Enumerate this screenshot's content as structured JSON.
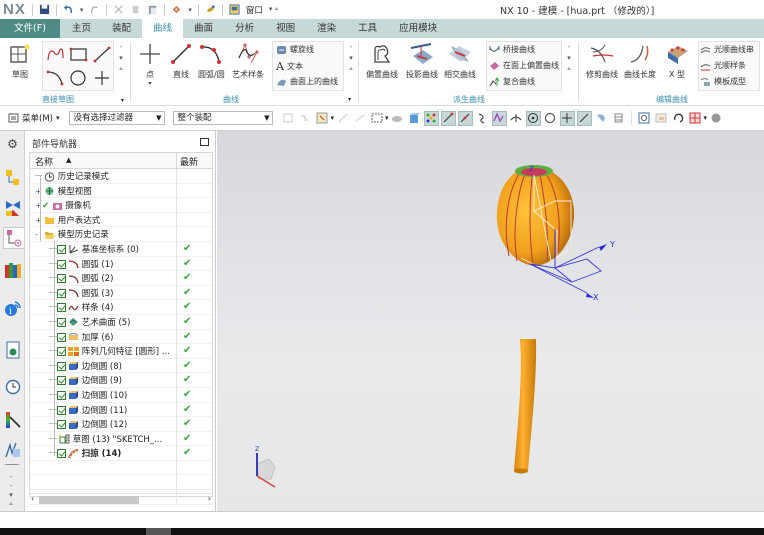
{
  "app": {
    "logo": "NX",
    "title": "NX 10 - 建模 - [hua.prt （修改的）]",
    "window_menu": "窗口"
  },
  "menu_tabs": [
    {
      "label": "文件(F)",
      "state": "file"
    },
    {
      "label": "主页"
    },
    {
      "label": "装配"
    },
    {
      "label": "曲线",
      "state": "active"
    },
    {
      "label": "曲面"
    },
    {
      "label": "分析"
    },
    {
      "label": "视图"
    },
    {
      "label": "渲染"
    },
    {
      "label": "工具"
    },
    {
      "label": "应用模块"
    }
  ],
  "ribbon": {
    "groups": {
      "direct_sketch": "直接草图",
      "curve": "曲线",
      "derived_curve": "派生曲线",
      "edit_curve": "编辑曲线"
    },
    "sketch": "草图",
    "point": "点",
    "line": "直线",
    "arc_circle": "圆弧/圆",
    "studio_spline": "艺术样条",
    "helix": "螺旋线",
    "text": "文本",
    "curve_on_surface": "曲面上的曲线",
    "offset_curve": "偏置曲线",
    "project_curve": "投影曲线",
    "intersect_curve": "相交曲线",
    "bridge_curve": "桥接曲线",
    "offset_in_face": "在面上偏置曲线",
    "composite_curve": "复合曲线",
    "trim_curve": "修剪曲线",
    "curve_length": "曲线长度",
    "x_form": "X 型",
    "smooth_curve_string": "光顺曲线串",
    "smooth_spline": "光顺样条",
    "template_shape": "模板成型"
  },
  "toolbar2": {
    "menu": "菜单(M)",
    "filter": "没有选择过滤器",
    "scope": "整个装配"
  },
  "navigator": {
    "title": "部件导航器",
    "col_name": "名称",
    "col_latest": "最新",
    "items": [
      {
        "label": "历史记录模式",
        "level": 0,
        "icon": "clock-icon"
      },
      {
        "label": "模型视图",
        "level": 0,
        "icon": "model-view-icon",
        "expander": "+"
      },
      {
        "label": "摄像机",
        "level": 0,
        "icon": "camera-icon",
        "expander": "+",
        "check": "✔"
      },
      {
        "label": "用户表达式",
        "level": 0,
        "icon": "folder-icon",
        "expander": "+"
      },
      {
        "label": "模型历史记录",
        "level": 0,
        "icon": "folder-open-icon",
        "expander": "−"
      },
      {
        "label": "基准坐标系 (0)",
        "level": 1,
        "icon": "datum-csys-icon",
        "latest": "✔"
      },
      {
        "label": "圆弧 (1)",
        "level": 1,
        "icon": "arc-icon",
        "latest": "✔"
      },
      {
        "label": "圆弧 (2)",
        "level": 1,
        "icon": "arc-icon",
        "latest": "✔"
      },
      {
        "label": "圆弧 (3)",
        "level": 1,
        "icon": "arc-icon",
        "latest": "✔"
      },
      {
        "label": "样条 (4)",
        "level": 1,
        "icon": "spline-icon",
        "latest": "✔"
      },
      {
        "label": "艺术曲面 (5)",
        "level": 1,
        "icon": "studio-surface-icon",
        "latest": "✔"
      },
      {
        "label": "加厚 (6)",
        "level": 1,
        "icon": "thicken-icon",
        "latest": "✔"
      },
      {
        "label": "阵列几何特征 [圆形] ...",
        "level": 1,
        "icon": "pattern-icon",
        "latest": "✔"
      },
      {
        "label": "边倒圆 (8)",
        "level": 1,
        "icon": "edge-blend-icon",
        "latest": "✔"
      },
      {
        "label": "边倒圆 (9)",
        "level": 1,
        "icon": "edge-blend-icon",
        "latest": "✔"
      },
      {
        "label": "边倒圆 (10)",
        "level": 1,
        "icon": "edge-blend-icon",
        "latest": "✔"
      },
      {
        "label": "边倒圆 (11)",
        "level": 1,
        "icon": "edge-blend-icon",
        "latest": "✔"
      },
      {
        "label": "边倒圆 (12)",
        "level": 1,
        "icon": "edge-blend-icon",
        "latest": "✔"
      },
      {
        "label": "草图 (13) \"SKETCH_...",
        "level": 1,
        "icon": "sketch-icon",
        "latest": "✔",
        "nocheck": true
      },
      {
        "label": "扫掠 (14)",
        "level": 1,
        "icon": "sweep-icon",
        "latest": "✔",
        "bold": true
      }
    ]
  },
  "viewport": {
    "csys_labels": {
      "x": "X",
      "y": "Y",
      "z": "Z"
    },
    "model_color": "#f0a01c"
  },
  "colors": {
    "accent": "#3a8ea8",
    "file_tab": "#4e8b84",
    "menubar": "#c7d8d8",
    "check_green": "#3aa53a"
  }
}
